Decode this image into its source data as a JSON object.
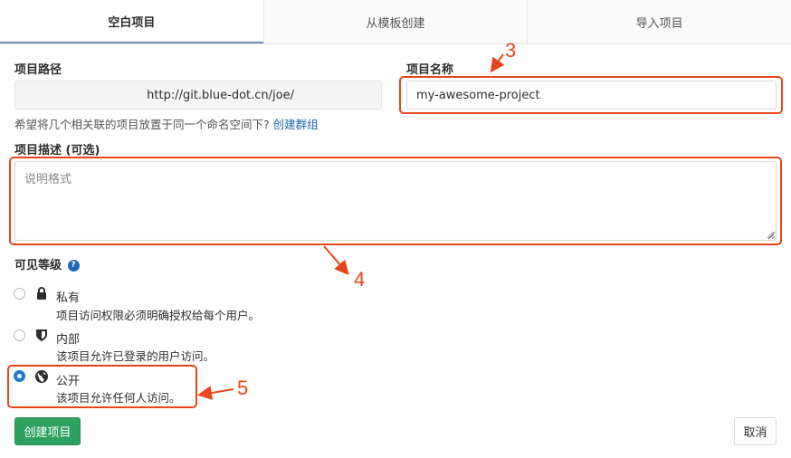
{
  "tabs": [
    {
      "label": "空白项目",
      "active": true
    },
    {
      "label": "从模板创建",
      "active": false
    },
    {
      "label": "导入项目",
      "active": false
    }
  ],
  "form": {
    "path_label": "项目路径",
    "path_value": "http://git.blue-dot.cn/joe/",
    "name_label": "项目名称",
    "name_value": "my-awesome-project",
    "help_text": "希望将几个相关联的项目放置于同一个命名空间下?",
    "help_link": "创建群组",
    "desc_label": "项目描述 (可选)",
    "desc_placeholder": "说明格式",
    "visibility_label": "可见等级",
    "visibility_help_icon": "question-circle-icon",
    "options": [
      {
        "icon": "lock-icon",
        "title": "私有",
        "desc": "项目访问权限必须明确授权给每个用户。",
        "checked": false
      },
      {
        "icon": "shield-icon",
        "title": "内部",
        "desc": "该项目允许已登录的用户访问。",
        "checked": false
      },
      {
        "icon": "globe-icon",
        "title": "公开",
        "desc": "该项目允许任何人访问。",
        "checked": true
      }
    ],
    "create_button": "创建项目",
    "cancel_button": "取消"
  },
  "annotations": {
    "color": "#e8461a",
    "labels": [
      "3",
      "4",
      "5"
    ]
  },
  "colors": {
    "accent": "#1f78d1",
    "create_button": "#2da160",
    "annotation": "#e8461a"
  }
}
